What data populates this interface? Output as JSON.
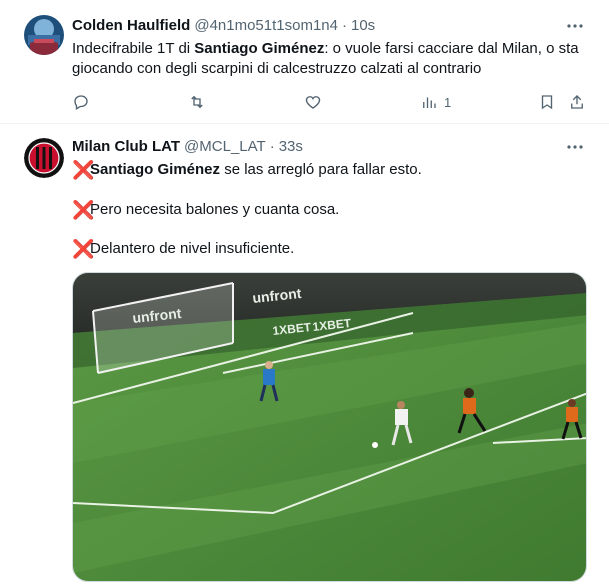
{
  "tweets": [
    {
      "display_name": "Colden Haulfield",
      "handle": "@4n1mo51t1som1n4",
      "separator": "·",
      "time": "10s",
      "text_part1": "Indecifrabile 1T di ",
      "text_bold": "Santiago Giménez",
      "text_part2": ": o vuole farsi cacciare dal Milan, o sta giocando con degli scarpini di calcestruzzo calzati al contrario",
      "actions": {
        "reply_icon": "reply-icon",
        "retweet_icon": "retweet-icon",
        "like_icon": "heart-icon",
        "views_icon": "views-icon",
        "views_count": "1",
        "bookmark_icon": "bookmark-icon",
        "share_icon": "share-icon"
      }
    },
    {
      "display_name": "Milan Club LAT",
      "handle": "@MCL_LAT",
      "separator": "·",
      "time": "33s",
      "lines": [
        {
          "mark": "❌",
          "bold": "Santiago Giménez",
          "rest": " se las arregló para fallar esto."
        },
        {
          "mark": "❌",
          "bold": "",
          "rest": "Pero necesita balones y cuanta cosa."
        },
        {
          "mark": "❌",
          "bold": "",
          "rest": "Delantero de nivel insuficiente."
        }
      ],
      "media": {
        "boards": [
          "unfront",
          "1XBET",
          "1XBET"
        ],
        "description_icon": "video-thumbnail"
      }
    }
  ],
  "colors": {
    "accent_red": "#e0245e",
    "muted": "#536471",
    "pitch": "#4f8a3b"
  }
}
